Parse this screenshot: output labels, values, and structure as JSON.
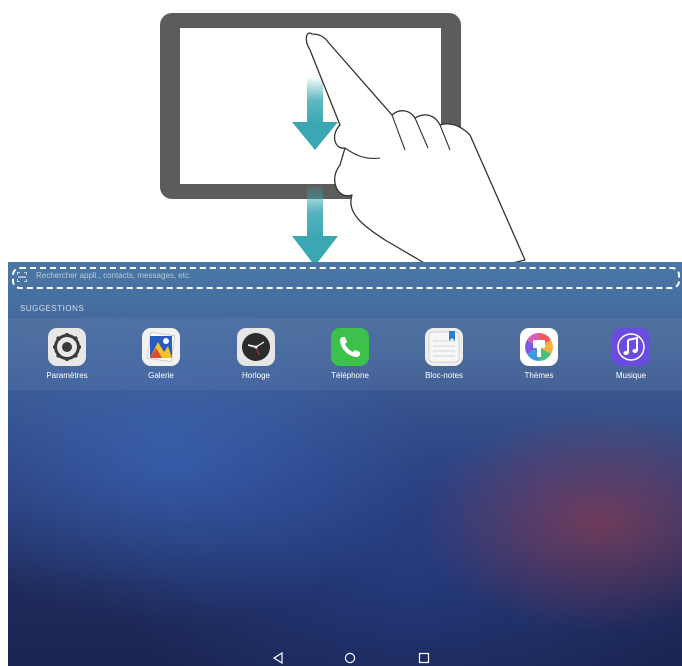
{
  "search": {
    "placeholder": "Rechercher appli., contacts, messages, etc."
  },
  "suggestions": {
    "label": "SUGGESTIONS",
    "apps": [
      {
        "name": "Paramètres",
        "icon": "settings-gear-icon"
      },
      {
        "name": "Galerie",
        "icon": "gallery-icon"
      },
      {
        "name": "Horloge",
        "icon": "clock-icon"
      },
      {
        "name": "Téléphone",
        "icon": "phone-icon"
      },
      {
        "name": "Bloc-notes",
        "icon": "notepad-icon"
      },
      {
        "name": "Thèmes",
        "icon": "themes-brush-icon"
      },
      {
        "name": "Musique",
        "icon": "music-note-icon"
      }
    ]
  },
  "navigation": {
    "buttons": [
      "back-icon",
      "home-icon",
      "recents-icon"
    ]
  },
  "colors": {
    "arrow": "#3aa7b3",
    "tablet_frame": "#5c5c5c",
    "phone_green": "#3cc14b",
    "music_purple": "#6a4de0"
  }
}
